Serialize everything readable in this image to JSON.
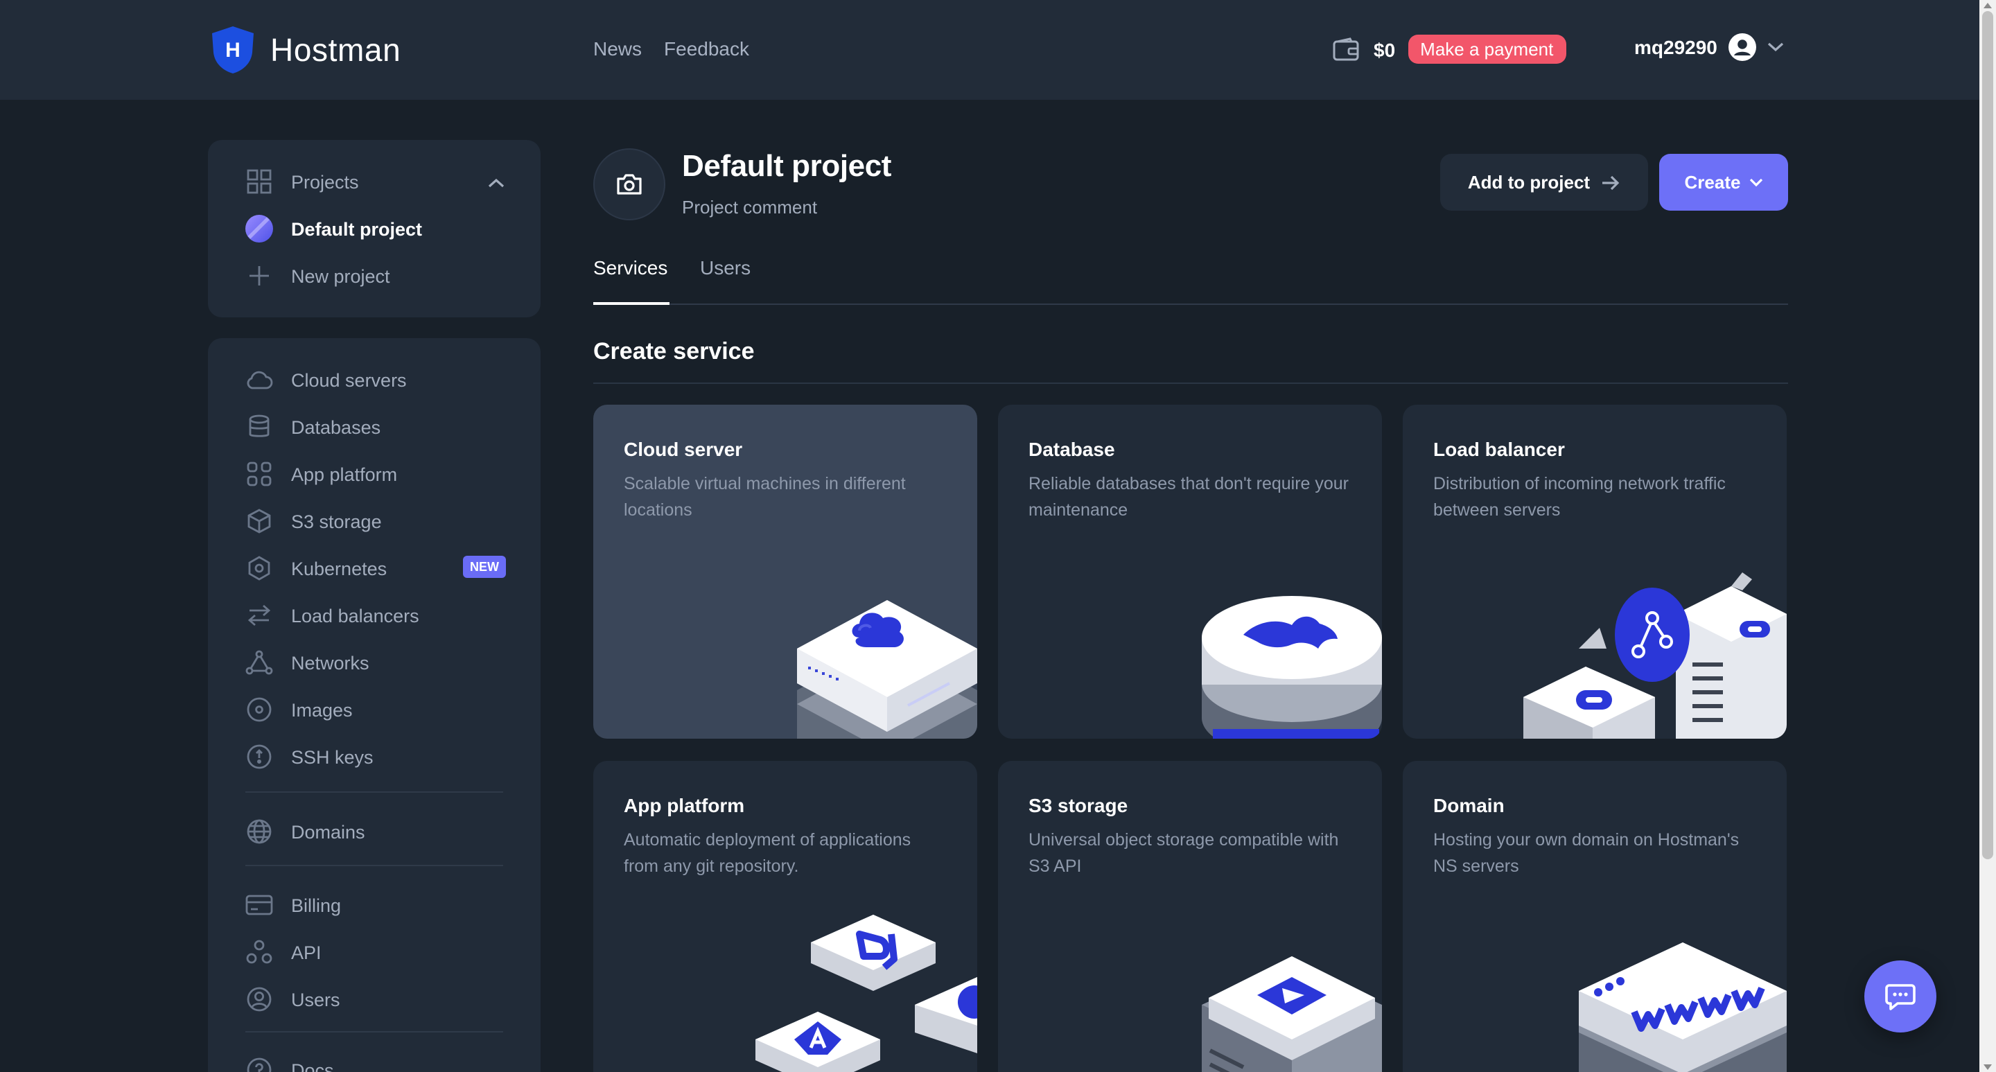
{
  "brand": {
    "name": "Hostman",
    "logo_letter": "H"
  },
  "topnav": {
    "news": "News",
    "feedback": "Feedback"
  },
  "wallet": {
    "amount": "$0",
    "pay_label": "Make a payment"
  },
  "user": {
    "username": "mq29290"
  },
  "projects": {
    "header": "Projects",
    "items": [
      {
        "label": "Default project",
        "active": true
      },
      {
        "label": "New project"
      }
    ]
  },
  "sidebar": {
    "items": [
      {
        "label": "Cloud servers",
        "icon": "cloud-icon"
      },
      {
        "label": "Databases",
        "icon": "database-icon"
      },
      {
        "label": "App platform",
        "icon": "grid-icon"
      },
      {
        "label": "S3 storage",
        "icon": "cube-icon"
      },
      {
        "label": "Kubernetes",
        "icon": "kubernetes-icon",
        "badge": "NEW"
      },
      {
        "label": "Load balancers",
        "icon": "arrows-icon"
      },
      {
        "label": "Networks",
        "icon": "network-icon"
      },
      {
        "label": "Images",
        "icon": "disc-icon"
      },
      {
        "label": "SSH keys",
        "icon": "key-icon"
      },
      {
        "label": "Domains",
        "icon": "globe-icon"
      },
      {
        "label": "Billing",
        "icon": "card-icon"
      },
      {
        "label": "API",
        "icon": "api-icon"
      },
      {
        "label": "Users",
        "icon": "user-icon"
      },
      {
        "label": "Docs",
        "icon": "help-icon"
      }
    ]
  },
  "project": {
    "title": "Default project",
    "comment": "Project comment"
  },
  "actions": {
    "add_to_project": "Add to project",
    "create": "Create"
  },
  "tabs": [
    {
      "label": "Services",
      "active": true
    },
    {
      "label": "Users"
    }
  ],
  "section": {
    "title": "Create service"
  },
  "cards": [
    {
      "title": "Cloud server",
      "desc": "Scalable virtual machines in different locations"
    },
    {
      "title": "Database",
      "desc": "Reliable databases that don't require your maintenance"
    },
    {
      "title": "Load balancer",
      "desc": "Distribution of incoming network traffic between servers"
    },
    {
      "title": "App platform",
      "desc": "Automatic deployment of applications from any git repository."
    },
    {
      "title": "S3 storage",
      "desc": "Universal object storage compatible with S3 API"
    },
    {
      "title": "Domain",
      "desc": "Hosting your own domain on Hostman's NS servers"
    }
  ],
  "colors": {
    "accent": "#6d70f7",
    "pay": "#f2566a",
    "background": "#182029",
    "panel": "#212b38"
  }
}
